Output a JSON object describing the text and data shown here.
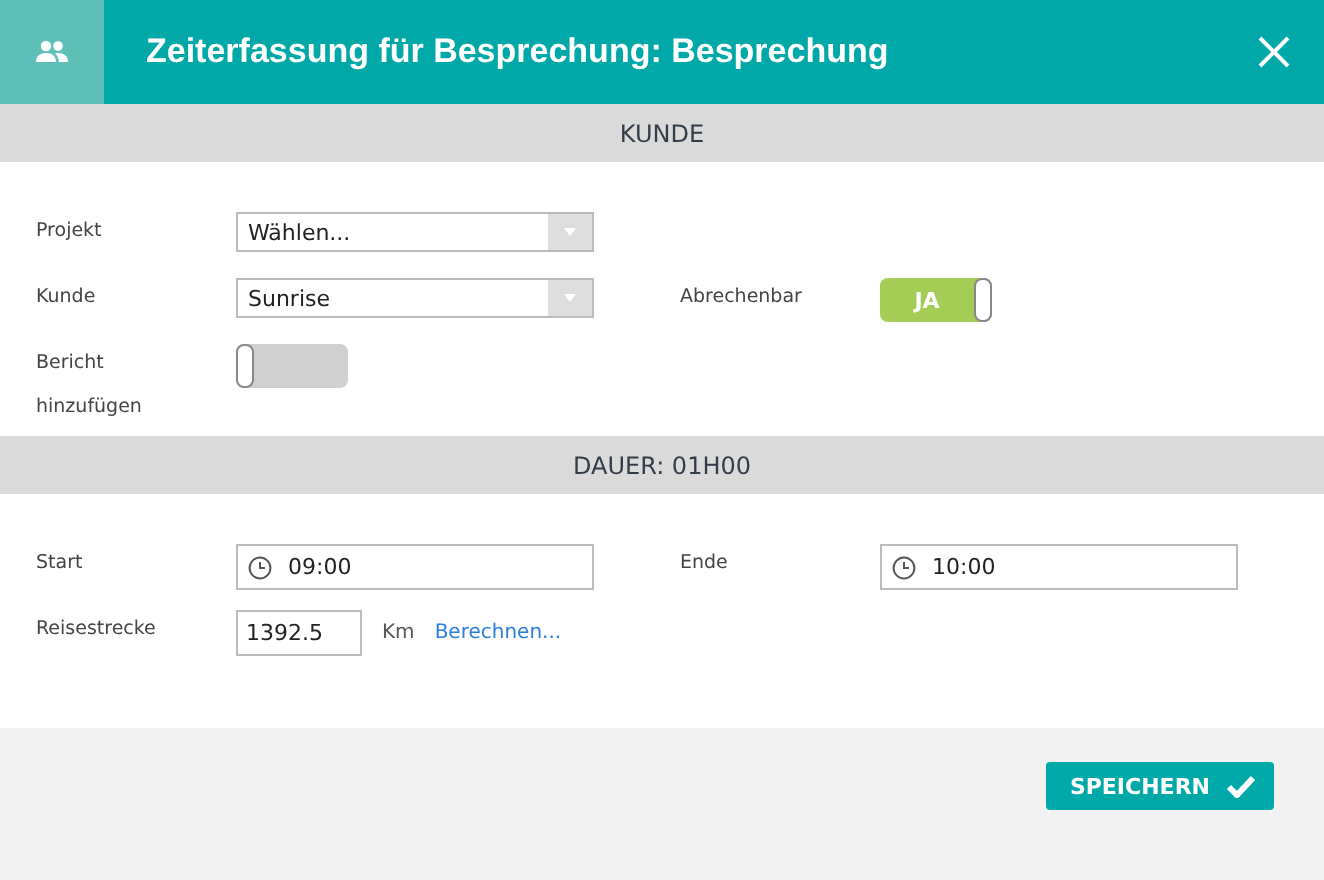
{
  "header": {
    "title": "Zeiterfassung für Besprechung: Besprechung"
  },
  "sections": [
    {
      "title": "KUNDE",
      "rows": [
        [
          {
            "kind": "select",
            "label": "Projekt",
            "value": "Wählen..."
          }
        ],
        [
          {
            "kind": "select",
            "label": "Kunde",
            "value": "Sunrise"
          },
          {
            "kind": "toggle",
            "label": "Abrechenbar",
            "on": true,
            "text": "JA"
          }
        ],
        [
          {
            "kind": "toggle",
            "label": "Bericht hinzufügen",
            "on": false
          }
        ]
      ]
    },
    {
      "title": "DAUER: 01H00",
      "rows": [
        [
          {
            "kind": "time",
            "label": "Start",
            "value": "09:00"
          },
          {
            "kind": "time",
            "label": "Ende",
            "value": "10:00"
          }
        ],
        [
          {
            "kind": "distance",
            "label": "Reisestrecke",
            "value": "1392.5",
            "unit": "Km",
            "link": "Berechnen..."
          }
        ]
      ]
    }
  ],
  "save_button": "SPEICHERN"
}
